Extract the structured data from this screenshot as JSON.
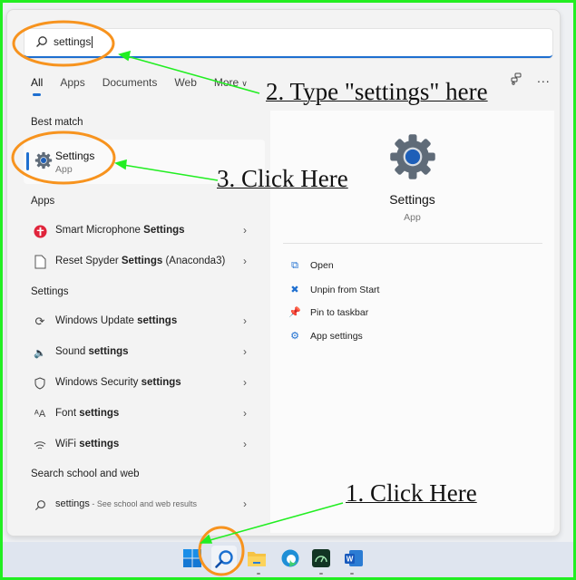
{
  "search": {
    "value": "settings",
    "icon": "search-icon"
  },
  "tabs": [
    {
      "label": "All",
      "active": true
    },
    {
      "label": "Apps",
      "active": false
    },
    {
      "label": "Documents",
      "active": false
    },
    {
      "label": "Web",
      "active": false
    },
    {
      "label": "More",
      "active": false
    }
  ],
  "toolbar": {
    "share_icon": "connected-devices-icon",
    "more_label": "..."
  },
  "best_match": {
    "section_label": "Best match",
    "title": "Settings",
    "subtitle": "App",
    "icon": "settings-gear-icon"
  },
  "apps": {
    "section_label": "Apps",
    "items": [
      {
        "prefix": "Smart Microphone ",
        "bold": "Settings",
        "suffix": "",
        "icon": "smart-microphone-icon"
      },
      {
        "prefix": "Reset Spyder ",
        "bold": "Settings",
        "suffix": " (Anaconda3)",
        "icon": "document-icon"
      }
    ]
  },
  "settings": {
    "section_label": "Settings",
    "items": [
      {
        "prefix": "Windows Update ",
        "bold": "settings",
        "icon": "refresh-icon"
      },
      {
        "prefix": "Sound ",
        "bold": "settings",
        "icon": "speaker-icon"
      },
      {
        "prefix": "Windows Security ",
        "bold": "settings",
        "icon": "shield-icon"
      },
      {
        "prefix": "Font ",
        "bold": "settings",
        "icon": "font-icon"
      },
      {
        "prefix": "WiFi ",
        "bold": "settings",
        "icon": "wifi-icon"
      }
    ]
  },
  "web": {
    "section_label": "Search school and web",
    "query": "settings",
    "hint": " - See school and web results"
  },
  "detail": {
    "title": "Settings",
    "subtitle": "App",
    "actions": [
      {
        "label": "Open",
        "icon": "open-external-icon"
      },
      {
        "label": "Unpin from Start",
        "icon": "unpin-icon"
      },
      {
        "label": "Pin to taskbar",
        "icon": "pin-icon"
      },
      {
        "label": "App settings",
        "icon": "gear-icon"
      }
    ]
  },
  "taskbar": {
    "items": [
      {
        "name": "start",
        "icon": "windows-start-icon"
      },
      {
        "name": "search",
        "icon": "search-icon"
      },
      {
        "name": "file-explorer",
        "icon": "folder-icon"
      },
      {
        "name": "edge",
        "icon": "edge-browser-icon"
      },
      {
        "name": "speed-app",
        "icon": "speedometer-icon"
      },
      {
        "name": "word",
        "icon": "word-icon"
      }
    ]
  },
  "annotations": {
    "step1": "1. Click Here",
    "step2": "2. Type \"settings\" here",
    "step3": "3. Click Here"
  },
  "colors": {
    "accent": "#1e6fd0",
    "highlight_ring": "#f7931e",
    "arrow": "#22ee22"
  }
}
